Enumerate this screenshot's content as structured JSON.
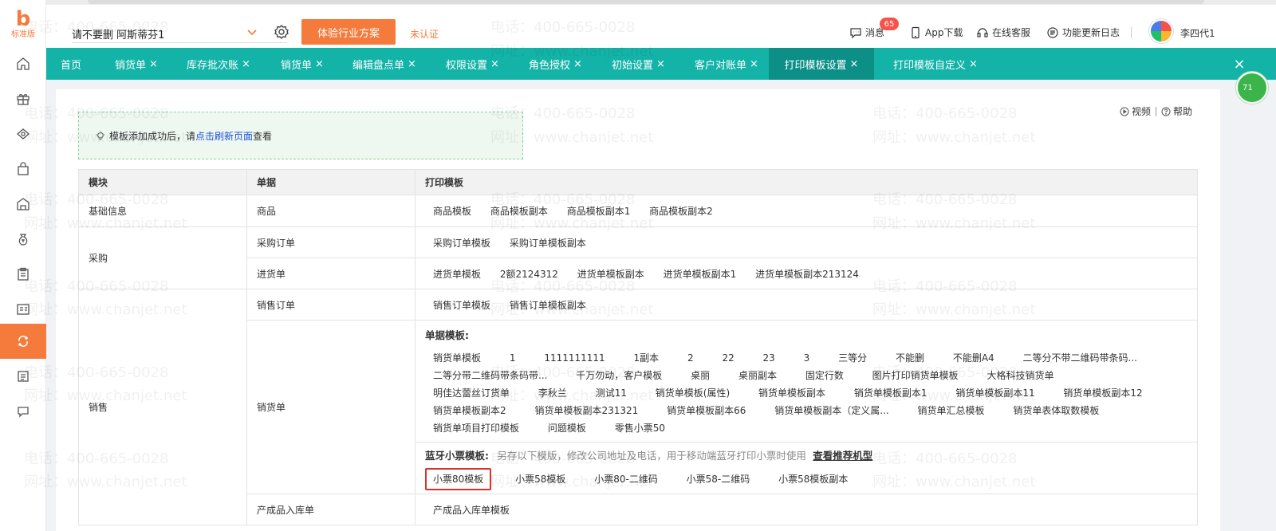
{
  "logo": {
    "mark": "b",
    "text": "标准版"
  },
  "header": {
    "company": "请不要删 阿斯蒂芬1",
    "trial_button": "体验行业方案",
    "unverified": "未认证",
    "messages_label": "消息",
    "messages_badge": "65",
    "app_download": "App下载",
    "online_service": "在线客服",
    "changelog": "功能更新日志",
    "user_name": "李四代1"
  },
  "tabs": [
    {
      "label": "首页",
      "closable": false
    },
    {
      "label": "销货单",
      "closable": true
    },
    {
      "label": "库存批次账",
      "closable": true
    },
    {
      "label": "销货单",
      "closable": true
    },
    {
      "label": "编辑盘点单",
      "closable": true
    },
    {
      "label": "权限设置",
      "closable": true
    },
    {
      "label": "角色授权",
      "closable": true
    },
    {
      "label": "初始设置",
      "closable": true
    },
    {
      "label": "客户对账单",
      "closable": true
    },
    {
      "label": "打印模板设置",
      "closable": true,
      "active": true
    },
    {
      "label": "打印模板自定义",
      "closable": true
    }
  ],
  "float_ball": "71",
  "help": {
    "video": "视频",
    "help": "帮助"
  },
  "notice": {
    "prefix": "模板添加成功后，请",
    "link": "点击刷新页面",
    "suffix": "查看"
  },
  "table": {
    "headers": {
      "module": "模块",
      "document": "单据",
      "template": "打印模板"
    },
    "basic": {
      "module": "基础信息",
      "doc": "商品",
      "templates": [
        "商品模板",
        "商品模板副本",
        "商品模板副本1",
        "商品模板副本2"
      ]
    },
    "purchase": {
      "module": "采购",
      "order": {
        "doc": "采购订单",
        "templates": [
          "采购订单模板",
          "采购订单模板副本"
        ]
      },
      "receipt": {
        "doc": "进货单",
        "templates": [
          "进货单模板",
          "2额2124312",
          "进货单模板副本",
          "进货单模板副本1",
          "进货单模板副本213124"
        ]
      }
    },
    "sales": {
      "module": "销售",
      "order": {
        "doc": "销售订单",
        "templates": [
          "销售订单模板",
          "销售订单模板副本"
        ]
      },
      "delivery": {
        "doc": "销货单",
        "doc_section_title": "单据模板:",
        "doc_templates_rows": [
          [
            "销货单模板",
            "1",
            "1111111111",
            "1副本",
            "2",
            "22",
            "23",
            "3",
            "三等分",
            "不能删",
            "不能删A4",
            "二等分不带二维码带条码..."
          ],
          [
            "二等分带二维码带条码带...",
            "千万勿动，客户模板",
            "桌丽",
            "桌丽副本",
            "固定行数",
            "图片打印销货单模板",
            "大格科技销货单"
          ],
          [
            "明佳达蕾丝订货单",
            "李秋兰",
            "测试11",
            "销货单模板(属性)",
            "销货单模板副本",
            "销货单模板副本1",
            "销货单模板副本11",
            "销货单模板副本12"
          ],
          [
            "销货单模板副本2",
            "销货单模板副本231321",
            "销货单模板副本66",
            "销货单模板副本（定义属...",
            "销货单汇总模板",
            "销货单表体取数模板"
          ],
          [
            "销货单项目打印模板",
            "问题模板",
            "零售小票50"
          ]
        ],
        "bt_section_title": "蓝牙小票模板:",
        "bt_note": "另存以下模版，修改公司地址及电话，用于移动端蓝牙打印小票时使用",
        "bt_link": "查看推荐机型",
        "bt_templates": [
          "小票80模板",
          "小票58模板",
          "小票80-二维码",
          "小票58-二维码",
          "小票58模板副本"
        ]
      },
      "next": {
        "doc": "产成品入库单",
        "templates": [
          "产成品入库单模板"
        ]
      }
    }
  },
  "watermark": {
    "phone": "电话：400-665-0028",
    "site": "网址：www.chanjet.net"
  },
  "colors": {
    "accent": "#f47b3b",
    "tab_bar": "#14b3a8",
    "tab_active": "#0b8f87",
    "highlight": "#d9302a"
  }
}
